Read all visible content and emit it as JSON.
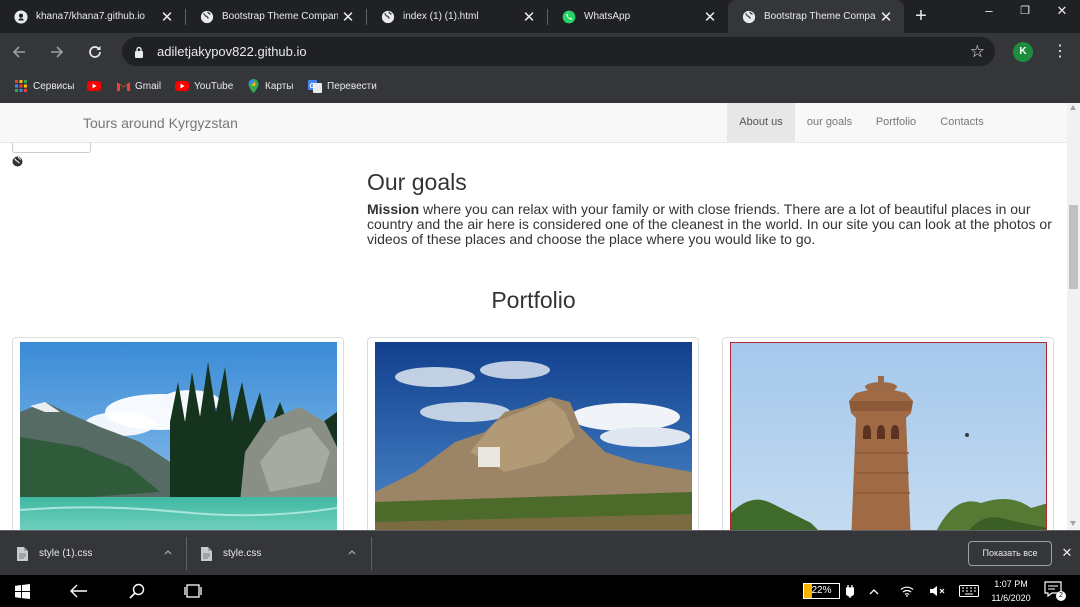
{
  "browser": {
    "tabs": [
      {
        "title": "khana7/khana7.github.io",
        "icon": "github-icon",
        "active": false
      },
      {
        "title": "Bootstrap Theme Company",
        "icon": "globe-icon",
        "active": false
      },
      {
        "title": "index (1) (1).html",
        "icon": "globe-icon",
        "active": false
      },
      {
        "title": "WhatsApp",
        "icon": "whatsapp-icon",
        "active": false
      },
      {
        "title": "Bootstrap Theme Company",
        "icon": "globe-icon",
        "active": true
      }
    ],
    "new_tab": "+",
    "window_controls": {
      "minimize": "–",
      "restore": "❐",
      "close": "✕"
    },
    "url": "adiletjakypov822.github.io",
    "profile_initial": "K",
    "profile_color": "#1e8e3e"
  },
  "bookmarks": [
    {
      "label": "Сервисы",
      "icon": "apps-grid-icon"
    },
    {
      "label": "",
      "icon": "youtube-icon"
    },
    {
      "label": "Gmail",
      "icon": "gmail-icon"
    },
    {
      "label": "YouTube",
      "icon": "youtube-icon"
    },
    {
      "label": "Карты",
      "icon": "maps-icon"
    },
    {
      "label": "Перевести",
      "icon": "translate-icon"
    }
  ],
  "site": {
    "brand": "Tours around Kyrgyzstan",
    "nav": [
      {
        "label": "About us",
        "active": true
      },
      {
        "label": "our goals",
        "active": false
      },
      {
        "label": "Portfolio",
        "active": false
      },
      {
        "label": "Contacts",
        "active": false
      }
    ],
    "goals_title": "Our goals",
    "goals_bold": "Mission",
    "goals_text": " where you can relax with your family or with close friends. There are a lot of beautiful places in our country and the air here is considered one of the cleanest in the world. In our site you can look at the photos or videos of these places and choose the place where you would like to go.",
    "portfolio_title": "Portfolio",
    "portfolio_images": [
      {
        "name": "mountain-lake-photo"
      },
      {
        "name": "rocky-mountain-photo"
      },
      {
        "name": "burana-tower-photo"
      }
    ]
  },
  "downloads": [
    {
      "filename": "style (1).css"
    },
    {
      "filename": "style.css"
    }
  ],
  "show_all_label": "Показать все",
  "taskbar": {
    "battery_percent": 22,
    "battery_label": "22%",
    "time": "1:07 PM",
    "date": "11/6/2020",
    "notification_count": "2"
  }
}
